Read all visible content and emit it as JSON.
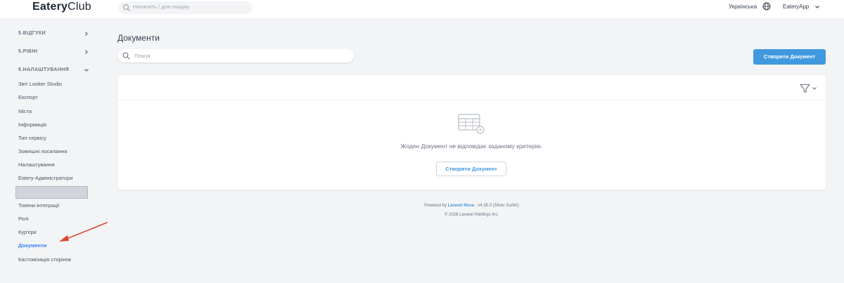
{
  "app": {
    "brand_bold": "Eatery",
    "brand_light": "Club"
  },
  "topbar": {
    "search_placeholder": "Натисніть / для пошуку",
    "language": "Українська",
    "user": "EateryApp"
  },
  "sidebar": {
    "groups": [
      {
        "label": "5.ВІДГУКИ"
      },
      {
        "label": "5.РІВНІ"
      },
      {
        "label": "6.НАЛАШТУВАННЯ"
      }
    ],
    "items": [
      {
        "label": "Звіт Looker Studio"
      },
      {
        "label": "Експорт"
      },
      {
        "label": "Міста"
      },
      {
        "label": "Інформація"
      },
      {
        "label": "Тип сервісу"
      },
      {
        "label": "Зовнішні посилання"
      },
      {
        "label": "Налаштування"
      },
      {
        "label": "Eatery-Адміністратори"
      },
      {
        "label": "Токени інтеграції"
      },
      {
        "label": "Ролі"
      },
      {
        "label": "Кур'єри"
      },
      {
        "label": "Документи"
      },
      {
        "label": "Кастомізація сторінок"
      }
    ],
    "active_item": "Документи"
  },
  "main": {
    "title": "Документи",
    "search_placeholder": "Пошук",
    "create_button": "Створити Документ",
    "empty_message": "Жоден Документ не відповідає заданому критерію.",
    "empty_create_button": "Створити Документ"
  },
  "footer": {
    "powered_by": "Powered by",
    "nova": "Laravel Nova",
    "version": "· v4.35.0 (Silver Surfer)",
    "copyright": "© 2026 Laravel Holdings Inc."
  },
  "colors": {
    "accent": "#4099de",
    "annotation_arrow": "#e0442f"
  }
}
